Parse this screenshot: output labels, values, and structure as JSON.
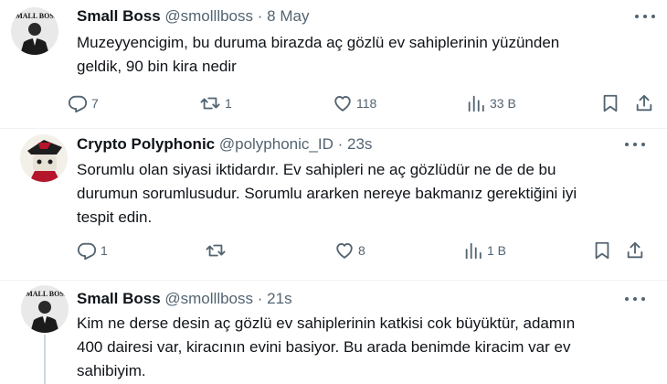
{
  "tweets": [
    {
      "name": "Small Boss",
      "handle": "@smolllboss",
      "separator": "·",
      "time": "8 May",
      "lines": [
        "Muzeyyencigim, bu duruma birazda aç gözlü ev sahiplerinin yüzünden",
        "geldik, 90 bin kira nedir"
      ],
      "replies": "7",
      "retweets": "1",
      "likes": "118",
      "views": "33 B",
      "avatar_text": "SMALL BOSS"
    },
    {
      "name": "Crypto Polyphonic",
      "handle": "@polyphonic_ID",
      "separator": "·",
      "time": "23s",
      "lines": [
        "Sorumlu olan siyasi iktidardır. Ev sahipleri ne aç gözlüdür ne de de bu",
        "durumun sorumlusudur. Sorumlu ararken nereye bakmanız gerektiğini iyi",
        "tespit edin."
      ],
      "replies": "1",
      "retweets": "",
      "likes": "8",
      "views": "1 B"
    },
    {
      "name": "Small Boss",
      "handle": "@smolllboss",
      "separator": "·",
      "time": "21s",
      "lines": [
        "Kim ne derse desin aç gözlü ev sahiplerinin katkisi cok büyüktür, adamın",
        "400 dairesi var, kiracının evini basiyor. Bu arada benimde kiracim var ev",
        "sahibiyim."
      ],
      "avatar_text": "SMALL BOSS"
    }
  ],
  "icons": {
    "reply": "reply-icon",
    "retweet": "retweet-icon",
    "like": "heart-icon",
    "views": "views-chart-icon",
    "bookmark": "bookmark-icon",
    "share": "share-icon",
    "more": "more-options-icon"
  },
  "colors": {
    "text": "#0f1419",
    "secondary": "#536471",
    "thread_line": "#cfd9de"
  }
}
